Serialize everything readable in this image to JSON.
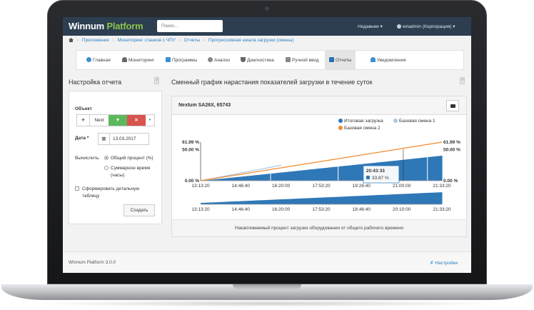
{
  "header": {
    "brand_main": "Winnum",
    "brand_accent": "Platform",
    "search_placeholder": "Поиск...",
    "recent_label": "Недавние ▾",
    "user_label": "wnadmin (Корпорация) ▾"
  },
  "breadcrumb": [
    "Приложения",
    "Мониторинг станков с ЧПУ",
    "Отчеты",
    "Прогрессивная шкала загрузки (смены)"
  ],
  "tabs": [
    {
      "label": "Главная",
      "icon": "home-icon",
      "color": "#3a8fd1"
    },
    {
      "label": "Мониторинг",
      "icon": "gauge-icon",
      "color": "#555555"
    },
    {
      "label": "Программы",
      "icon": "program-icon",
      "color": "#3a8fd1"
    },
    {
      "label": "Анализ",
      "icon": "pie-icon",
      "color": "#777777"
    },
    {
      "label": "Диагностика",
      "icon": "stethoscope-icon",
      "color": "#555555"
    },
    {
      "label": "Ручной ввод",
      "icon": "manual-icon",
      "color": "#777777"
    },
    {
      "label": "Отчеты",
      "icon": "report-icon",
      "color": "#2a6fb5",
      "active": true
    },
    {
      "label": "Уведомления",
      "icon": "bell-icon",
      "color": "#3a8fd1"
    }
  ],
  "settings_panel": {
    "title": "Настройка отчета",
    "help_label": "?",
    "object_label": "Объект",
    "object_value": "Next",
    "date_label": "Дата *",
    "date_value": "13.03.2017",
    "compute_label": "Вычислить:",
    "option_percent": "Общий процент (%)",
    "option_time_1": "Суммарное время",
    "option_time_2": "(часы)",
    "detail_label_1": "Сформировать детальную",
    "detail_label_2": "таблицу",
    "create_button": "Создать"
  },
  "report": {
    "title": "Сменный график нарастания показателей загрузки в течение суток",
    "machine": "Nextum SA26X, 65743",
    "footer_caption": "Накапливаемый процент загрузки оборудования от общего рабочего времени"
  },
  "chart_data": {
    "type": "area",
    "x": [
      "13:13:20",
      "14:46:40",
      "16:20:00",
      "17:53:20",
      "19:26:40",
      "21:00:00",
      "21:33:20"
    ],
    "y_left_ticks": [
      "61.99 %",
      "50.00 %",
      "0.00 %"
    ],
    "y_right_ticks": [
      "61.99 %",
      "50.00 %",
      "0.00 %"
    ],
    "ylim": [
      0,
      61.99
    ],
    "series": [
      {
        "name": "Итоговая загрузка",
        "color": "#2f78b8",
        "values": [
          0,
          6.6,
          13.3,
          20.1,
          26.8,
          33.5,
          40.5
        ]
      },
      {
        "name": "Базовая смена 1",
        "color": "#a9c9ea",
        "values": [
          0,
          12.4,
          24.8,
          null,
          null,
          null,
          null
        ]
      },
      {
        "name": "Базовая смена 2",
        "color": "#f28a2e",
        "values": [
          0,
          10.3,
          20.7,
          31.0,
          41.3,
          51.7,
          61.99
        ]
      }
    ],
    "navigator_ticks": [
      "13:13:20",
      "14:46:40",
      "16:20:00",
      "17:53:20",
      "18:46:40",
      "20:10:00",
      "21:33:20"
    ],
    "tooltip": {
      "time": "20:43:33",
      "value": "33.87 %"
    },
    "legend_position": "top-right"
  },
  "footer": {
    "version": "Winnum Platform 3.0.0",
    "settings_link": "Настройки"
  }
}
